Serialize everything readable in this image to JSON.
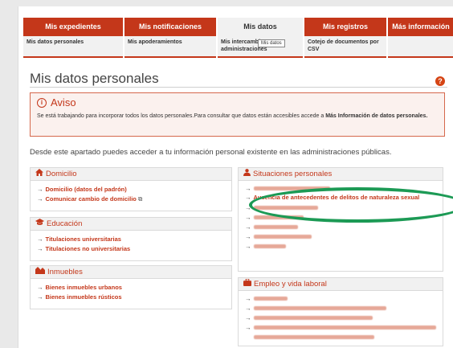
{
  "nav": {
    "tabs": [
      {
        "label": "Mis expedientes",
        "sub": "Mis datos personales"
      },
      {
        "label": "Mis notificaciones",
        "sub": "Mis apoderamientos"
      },
      {
        "label": "Mis datos",
        "sub": "Mis intercambios entre administraciones"
      },
      {
        "label": "Mis registros",
        "sub": "Cotejo de documentos por CSV"
      },
      {
        "label": "Más información",
        "sub": ""
      }
    ],
    "tooltip": "Mis datos"
  },
  "page_title": "Mis datos personales",
  "help_glyph": "?",
  "aviso": {
    "icon_glyph": "i",
    "title": "Aviso",
    "text": "Se está trabajando para incorporar todos los datos personales.Para consultar que datos están accesibles accede a",
    "bold": "Más Información de datos personales."
  },
  "intro": "Desde este apartado puedes acceder a tu información personal existente en las administraciones públicas.",
  "domicilio": {
    "title": "Domicilio",
    "links": [
      "Domicilio (datos del padrón)",
      "Comunicar cambio de domicilio"
    ]
  },
  "educacion": {
    "title": "Educación",
    "links": [
      "Titulaciones universitarias",
      "Titulaciones no universitarias"
    ]
  },
  "inmuebles": {
    "title": "Inmuebles",
    "links": [
      "Bienes inmuebles urbanos",
      "Bienes inmuebles rústicos"
    ]
  },
  "situaciones": {
    "title": "Situaciones personales",
    "highlight": "Ausencia de antecedentes de delitos de naturaleza sexual"
  },
  "empleo": {
    "title": "Empleo y vida laboral"
  },
  "arrow": "→",
  "external_glyph": "⧉",
  "colors": {
    "brand": "#c4371a",
    "highlight_ring": "#1c9a55"
  }
}
